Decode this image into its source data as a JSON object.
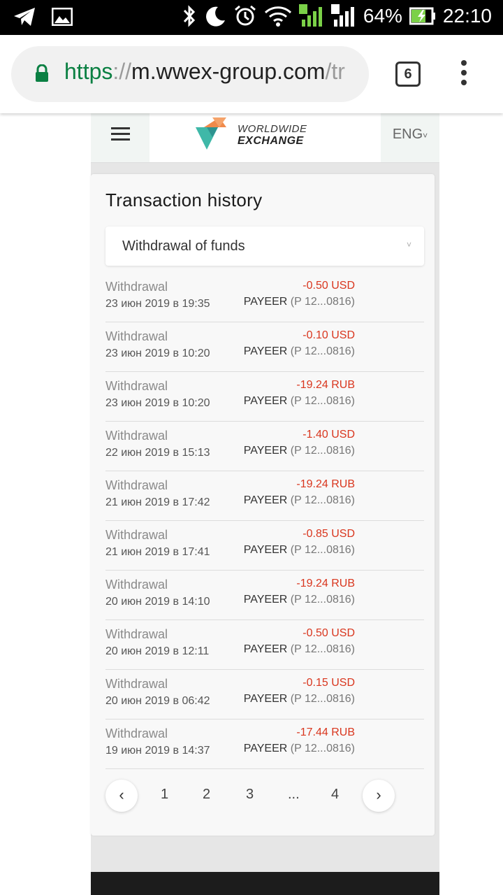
{
  "status_bar": {
    "battery": "64%",
    "time": "22:10",
    "sim1": "1",
    "sim2": "2"
  },
  "browser": {
    "url_scheme": "https",
    "url_sep": "://",
    "url_host": "m.wwex-group.com",
    "url_path": "/tr",
    "tab_count": "6"
  },
  "header": {
    "logo_line1": "WORLDWIDE",
    "logo_line2": "EXCHANGE",
    "lang": "ENG",
    "lang_chevron": "˅"
  },
  "content": {
    "title": "Transaction history",
    "filter_value": "Withdrawal of funds",
    "filter_chevron": "˅"
  },
  "transactions": [
    {
      "type": "Withdrawal",
      "date": "23 июн 2019 в 19:35",
      "amount": "-0.50 USD",
      "method": "PAYEER",
      "account": "(P 12...0816)"
    },
    {
      "type": "Withdrawal",
      "date": "23 июн 2019 в 10:20",
      "amount": "-0.10 USD",
      "method": "PAYEER",
      "account": "(P 12...0816)"
    },
    {
      "type": "Withdrawal",
      "date": "23 июн 2019 в 10:20",
      "amount": "-19.24 RUB",
      "method": "PAYEER",
      "account": "(P 12...0816)"
    },
    {
      "type": "Withdrawal",
      "date": "22 июн 2019 в 15:13",
      "amount": "-1.40 USD",
      "method": "PAYEER",
      "account": "(P 12...0816)"
    },
    {
      "type": "Withdrawal",
      "date": "21 июн 2019 в 17:42",
      "amount": "-19.24 RUB",
      "method": "PAYEER",
      "account": "(P 12...0816)"
    },
    {
      "type": "Withdrawal",
      "date": "21 июн 2019 в 17:41",
      "amount": "-0.85 USD",
      "method": "PAYEER",
      "account": "(P 12...0816)"
    },
    {
      "type": "Withdrawal",
      "date": "20 июн 2019 в 14:10",
      "amount": "-19.24 RUB",
      "method": "PAYEER",
      "account": "(P 12...0816)"
    },
    {
      "type": "Withdrawal",
      "date": "20 июн 2019 в 12:11",
      "amount": "-0.50 USD",
      "method": "PAYEER",
      "account": "(P 12...0816)"
    },
    {
      "type": "Withdrawal",
      "date": "20 июн 2019 в 06:42",
      "amount": "-0.15 USD",
      "method": "PAYEER",
      "account": "(P 12...0816)"
    },
    {
      "type": "Withdrawal",
      "date": "19 июн 2019 в 14:37",
      "amount": "-17.44 RUB",
      "method": "PAYEER",
      "account": "(P 12...0816)"
    }
  ],
  "pagination": {
    "prev": "‹",
    "next": "›",
    "pages": [
      "1",
      "2",
      "3",
      "...",
      "4"
    ]
  },
  "colors": {
    "accent_green": "#0b8043",
    "negative_amount": "#d9361e"
  }
}
